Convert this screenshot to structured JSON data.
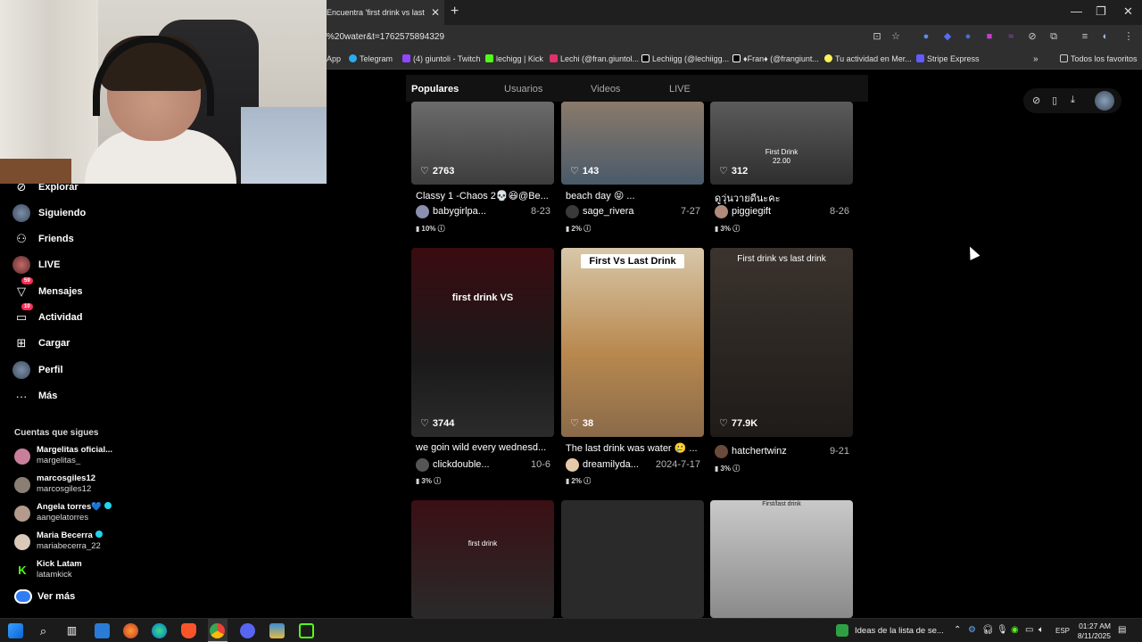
{
  "browser": {
    "tab_title": "Encuentra 'first drink vs last",
    "url": "%20water&t=1762575894329",
    "bookmarks": [
      {
        "label": "App",
        "color": "#5f6368"
      },
      {
        "label": "Telegram",
        "color": "#2aabee"
      },
      {
        "label": "(4) giuntoli - Twitch",
        "color": "#9146ff"
      },
      {
        "label": "lechigg | Kick",
        "color": "#53fc18"
      },
      {
        "label": "Lechi (@fran.giuntol...",
        "color": "#e1306c"
      },
      {
        "label": "Lechiigg (@lechiigg...",
        "color": "#ffffff"
      },
      {
        "label": "♦Fran♦ (@frangiunt...",
        "color": "#ffffff"
      },
      {
        "label": "Tu actividad en Mer...",
        "color": "#fff159"
      },
      {
        "label": "Stripe Express",
        "color": "#635bff"
      }
    ],
    "favorites_label": "Todos los favoritos"
  },
  "sidebar": {
    "items": [
      {
        "label": "Explorar",
        "icon": "compass-icon",
        "glyph": "⊘"
      },
      {
        "label": "Siguiendo",
        "icon": "following-avatar-icon",
        "glyph": ""
      },
      {
        "label": "Friends",
        "icon": "friends-icon",
        "glyph": "👥"
      },
      {
        "label": "LIVE",
        "icon": "live-avatar-icon",
        "glyph": ""
      },
      {
        "label": "Mensajes",
        "icon": "messages-icon",
        "glyph": "▽",
        "badge": "59"
      },
      {
        "label": "Actividad",
        "icon": "activity-icon",
        "glyph": "▭",
        "badge": "10"
      },
      {
        "label": "Cargar",
        "icon": "upload-icon",
        "glyph": "⊞"
      },
      {
        "label": "Perfil",
        "icon": "profile-avatar-icon",
        "glyph": ""
      },
      {
        "label": "Más",
        "icon": "more-icon",
        "glyph": "···"
      }
    ],
    "following_title": "Cuentas que sigues",
    "accounts": [
      {
        "name": "Margelitas oficial...",
        "handle": "margelitas_",
        "verified": false,
        "color": "#c97f9a"
      },
      {
        "name": "marcosgiles12",
        "handle": "marcosgiles12",
        "verified": false,
        "color": "#8a7f73"
      },
      {
        "name": "Angela torres💙",
        "handle": "aangelatorres",
        "verified": true,
        "color": "#b39a8a"
      },
      {
        "name": "Maria Becerra",
        "handle": "mariabecerra_22",
        "verified": true,
        "color": "#d9c9b8"
      },
      {
        "name": "Kick Latam",
        "handle": "latamkick",
        "verified": false,
        "color": "#53fc18"
      }
    ],
    "see_more": "Ver más"
  },
  "results_tabs": [
    "Populares",
    "Usuarios",
    "Videos",
    "LIVE"
  ],
  "videos": [
    {
      "likes": "2763",
      "caption": "Classy 1 -Chaos 2💀😆@Be...",
      "user": "babygirlpa...",
      "date": "8-23",
      "pct": "10%",
      "overlay": "",
      "bg": "linear-gradient(180deg,#6b6b6b,#3d3d3d)"
    },
    {
      "likes": "143",
      "caption": "beach day 😝 ...",
      "user": "sage_rivera",
      "date": "7-27",
      "pct": "2%",
      "overlay": "",
      "bg": "linear-gradient(180deg,#8a7a6a,#4a5a6a)"
    },
    {
      "likes": "312",
      "caption": "ดูวุ่นวายดีนะคะ",
      "user": "piggiegift",
      "date": "8-26",
      "pct": "3%",
      "overlay": "First Drink\n22.00",
      "bg": "linear-gradient(180deg,#5b5b5b,#2e2e2e)"
    },
    {
      "likes": "3744",
      "caption": "we goin wild every wednesd...",
      "user": "clickdouble...",
      "date": "10-6",
      "pct": "3%",
      "overlay": "first drink VS",
      "bg": "linear-gradient(180deg,#3a0b10,#1a1a1a 60%,#2b2b2b)"
    },
    {
      "likes": "38",
      "caption": "The last drink was water 🥲 ...",
      "user": "dreamilyda...",
      "date": "2024-7-17",
      "pct": "2%",
      "overlay": "First Vs Last Drink",
      "bg": "linear-gradient(180deg,#d7c7a9,#b9894f 55%,#8a6a4a)"
    },
    {
      "likes": "77.9K",
      "caption": "",
      "user": "hatchertwinz",
      "date": "9-21",
      "pct": "3%",
      "overlay": "First drink vs last drink",
      "bg": "linear-gradient(180deg,#3a332e,#1f1b18)"
    },
    {
      "likes": "",
      "caption": "",
      "user": "",
      "date": "",
      "pct": "",
      "overlay": "first drink",
      "bg": "linear-gradient(180deg,#3a0f14,#2a2a2a)"
    },
    {
      "likes": "",
      "caption": "",
      "user": "",
      "date": "",
      "pct": "",
      "overlay": "",
      "bg": "#2a2a2a"
    },
    {
      "likes": "",
      "caption": "",
      "user": "",
      "date": "",
      "pct": "",
      "overlay": "First/last drink",
      "bg": "linear-gradient(180deg,#c9c9c9,#8a8a8a)"
    }
  ],
  "taskbar": {
    "news_text": "Ideas de la lista de se...",
    "language": "ESP",
    "time": "01:27 AM",
    "date": "8/11/2025"
  }
}
